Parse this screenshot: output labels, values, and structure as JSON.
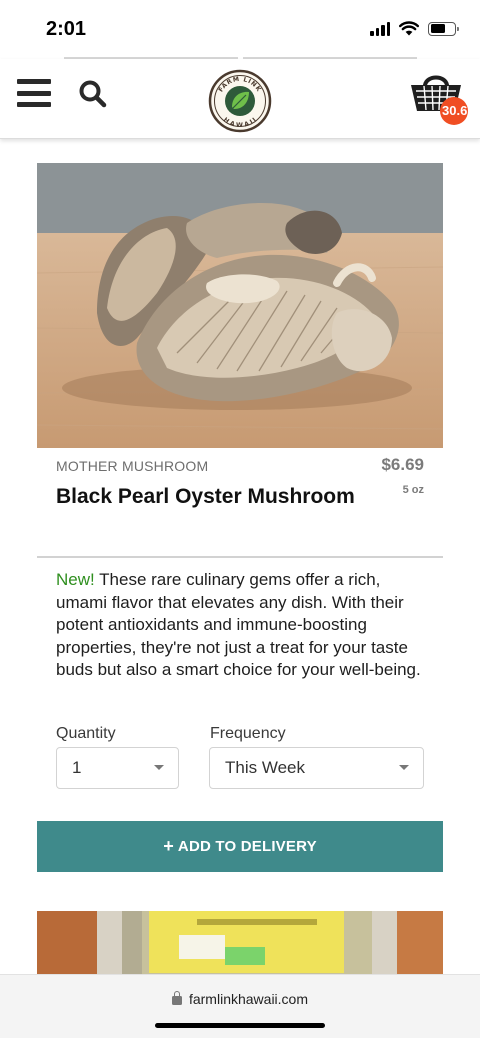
{
  "status_bar": {
    "time": "2:01"
  },
  "header": {
    "logo_text_top": "FARM LINK",
    "logo_text_bottom": "HAWAII",
    "cart_count": "30.6"
  },
  "product": {
    "brand": "MOTHER MUSHROOM",
    "price": "$6.69",
    "size": "5 oz",
    "title": "Black Pearl Oyster Mushroom",
    "description_new": "New!",
    "description": " These rare culinary gems offer a rich, umami flavor that elevates any dish. With their potent antioxidants and immune-boosting properties, they're not just a treat for your taste buds but also a smart choice for your well-being."
  },
  "form": {
    "quantity_label": "Quantity",
    "quantity_value": "1",
    "frequency_label": "Frequency",
    "frequency_value": "This Week",
    "add_button_icon": "+",
    "add_button_label": "ADD TO DELIVERY"
  },
  "browser": {
    "url": "farmlinkhawaii.com"
  },
  "colors": {
    "accent": "#3f8a8b",
    "badge": "#f04e23",
    "new_label": "#2f8f1f"
  }
}
